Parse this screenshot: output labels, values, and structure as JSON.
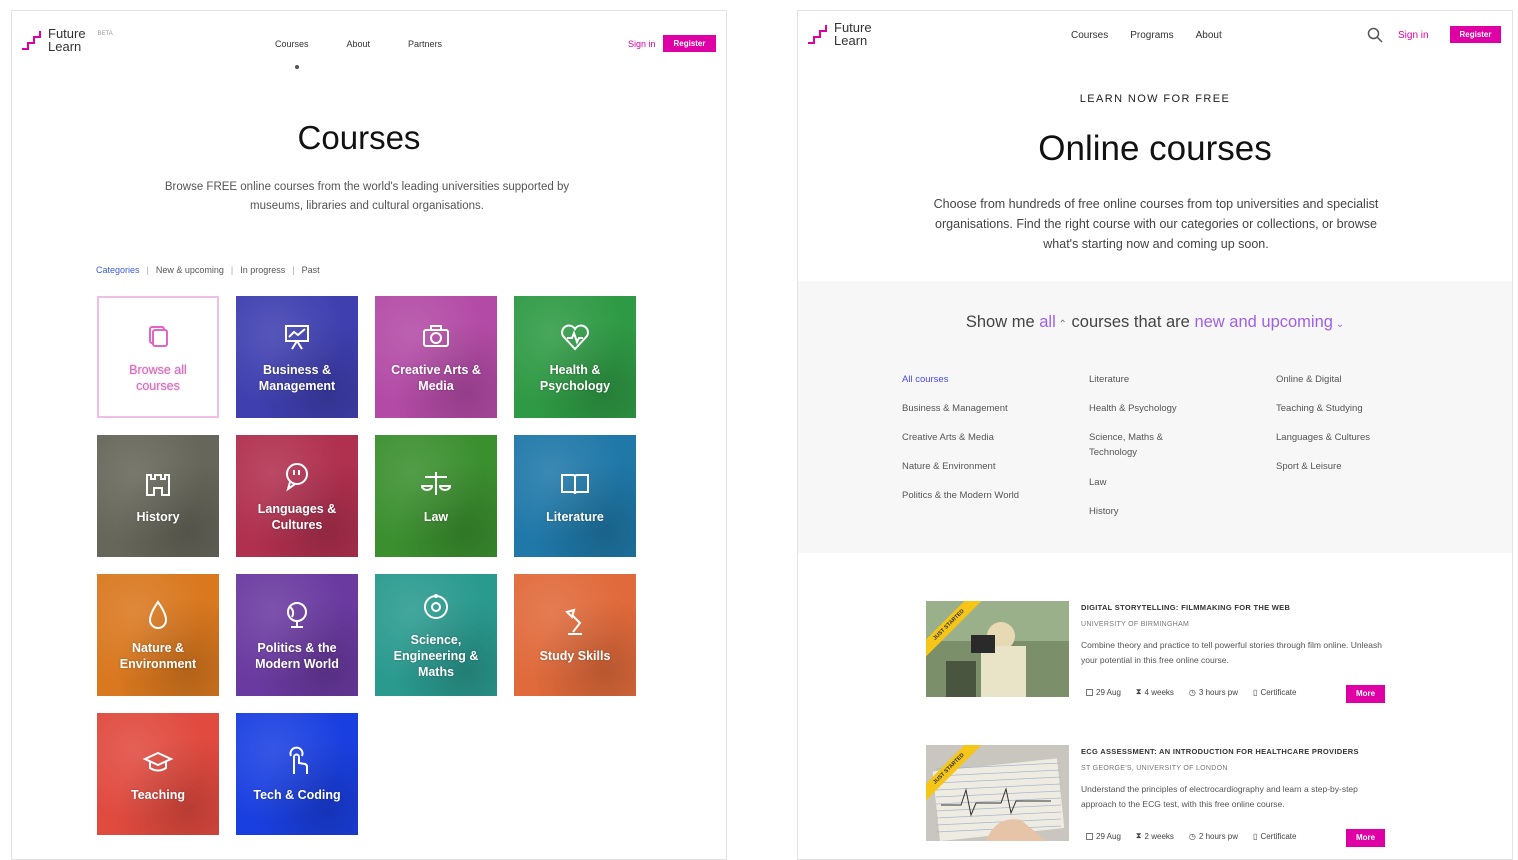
{
  "left": {
    "logo": {
      "line1": "Future",
      "line2": "Learn",
      "beta": "BETA"
    },
    "nav": [
      "Courses",
      "About",
      "Partners"
    ],
    "signin": "Sign in",
    "register": "Register",
    "title": "Courses",
    "subtitle": "Browse FREE online courses from the world's leading universities supported by museums, libraries and cultural organisations.",
    "filters": [
      "Categories",
      "New & upcoming",
      "In progress",
      "Past"
    ],
    "tiles": [
      {
        "label": "Browse all courses",
        "icon": "browse-icon",
        "color": "#ffffff"
      },
      {
        "label": "Business & Management",
        "icon": "presentation-chart-icon",
        "color": "#3f3fb0"
      },
      {
        "label": "Creative Arts & Media",
        "icon": "camera-icon",
        "color": "#b34ba6"
      },
      {
        "label": "Health & Psychology",
        "icon": "heart-pulse-icon",
        "color": "#2f9a45"
      },
      {
        "label": "History",
        "icon": "castle-icon",
        "color": "#66665a"
      },
      {
        "label": "Languages & Cultures",
        "icon": "speech-bubble-icon",
        "color": "#b0304f"
      },
      {
        "label": "Law",
        "icon": "scales-icon",
        "color": "#3b8f2f"
      },
      {
        "label": "Literature",
        "icon": "book-icon",
        "color": "#1f78a8"
      },
      {
        "label": "Nature & Environment",
        "icon": "leaf-drop-icon",
        "color": "#d9781f"
      },
      {
        "label": "Politics & the Modern World",
        "icon": "globe-icon",
        "color": "#6a3aa0"
      },
      {
        "label": "Science, Engineering & Maths",
        "icon": "atom-icon",
        "color": "#2a9a8f"
      },
      {
        "label": "Study Skills",
        "icon": "desk-lamp-icon",
        "color": "#e06a3b"
      },
      {
        "label": "Teaching",
        "icon": "graduation-cap-icon",
        "color": "#e04a3f"
      },
      {
        "label": "Tech & Coding",
        "icon": "touch-hand-icon",
        "color": "#1a3fe0"
      }
    ]
  },
  "right": {
    "logo": {
      "line1": "Future",
      "line2": "Learn"
    },
    "nav": [
      "Courses",
      "Programs",
      "About"
    ],
    "signin": "Sign in",
    "register": "Register",
    "kicker": "LEARN NOW FOR FREE",
    "title": "Online courses",
    "subtitle": "Choose from hundreds of free online courses from top universities and specialist organisations. Find the right course with our categories or collections, or browse what's starting now and coming up soon.",
    "showme": {
      "prefix": "Show me",
      "all": "all",
      "middle": "courses that are",
      "status": "new and upcoming"
    },
    "categories": [
      [
        "All courses",
        "Business & Management",
        "Creative Arts & Media",
        "Nature & Environment",
        "Politics & the Modern World"
      ],
      [
        "Literature",
        "Health & Psychology",
        "Science, Maths & Technology",
        "Law",
        "History"
      ],
      [
        "Online & Digital",
        "Teaching & Studying",
        "Languages & Cultures",
        "Sport & Leisure"
      ]
    ],
    "courses": [
      {
        "title": "DIGITAL STORYTELLING: FILMMAKING FOR THE WEB",
        "uni": "UNIVERSITY OF BIRMINGHAM",
        "desc": "Combine theory and practice to tell powerful stories through film online. Unleash your potential in this free online course.",
        "ribbon": "JUST STARTED",
        "date": "29 Aug",
        "weeks": "4 weeks",
        "hours": "3 hours pw",
        "cert": "Certificate",
        "more": "More"
      },
      {
        "title": "ECG ASSESSMENT: AN INTRODUCTION FOR HEALTHCARE PROVIDERS",
        "uni": "ST GEORGE'S, UNIVERSITY OF LONDON",
        "desc": "Understand the principles of electrocardiography and learn a step-by-step approach to the ECG test, with this free online course.",
        "ribbon": "JUST STARTED",
        "date": "29 Aug",
        "weeks": "2 weeks",
        "hours": "2 hours pw",
        "cert": "Certificate",
        "more": "More"
      }
    ]
  },
  "colors": {
    "brand": "#de00a5",
    "link": "#3b5bdb",
    "purple": "#9f61e8"
  }
}
